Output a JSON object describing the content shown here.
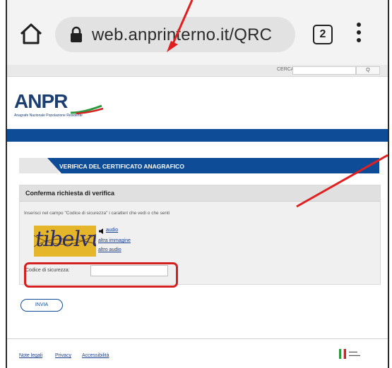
{
  "browser": {
    "url": "web.anprinterno.it/QRC",
    "tab_count": "2"
  },
  "site": {
    "search_label": "CERCA",
    "search_button": "Q",
    "logo_word": "ANPR",
    "logo_subtitle": "Anagrafe Nazionale Popolazione Residente"
  },
  "section": {
    "title": "VERIFICA DEL CERTIFICATO ANAGRAFICO"
  },
  "form": {
    "panel_title": "Conferma richiesta di verifica",
    "instructions": "Inserisci nel campo \"Codice di sicurezza\" i caratteri che vedi o che senti",
    "captcha_text": "tibelvu",
    "link_audio": "audio",
    "link_other_image": "altra immagine",
    "link_other_audio": "altro audio",
    "code_label": "Codice di sicurezza:",
    "code_value": "",
    "submit_label": "INVIA"
  },
  "footer": {
    "legal": "Note legali",
    "privacy": "Privacy",
    "accessibility": "Accessibilità"
  },
  "colors": {
    "accent": "#0e4c97",
    "highlight": "#d42020"
  }
}
